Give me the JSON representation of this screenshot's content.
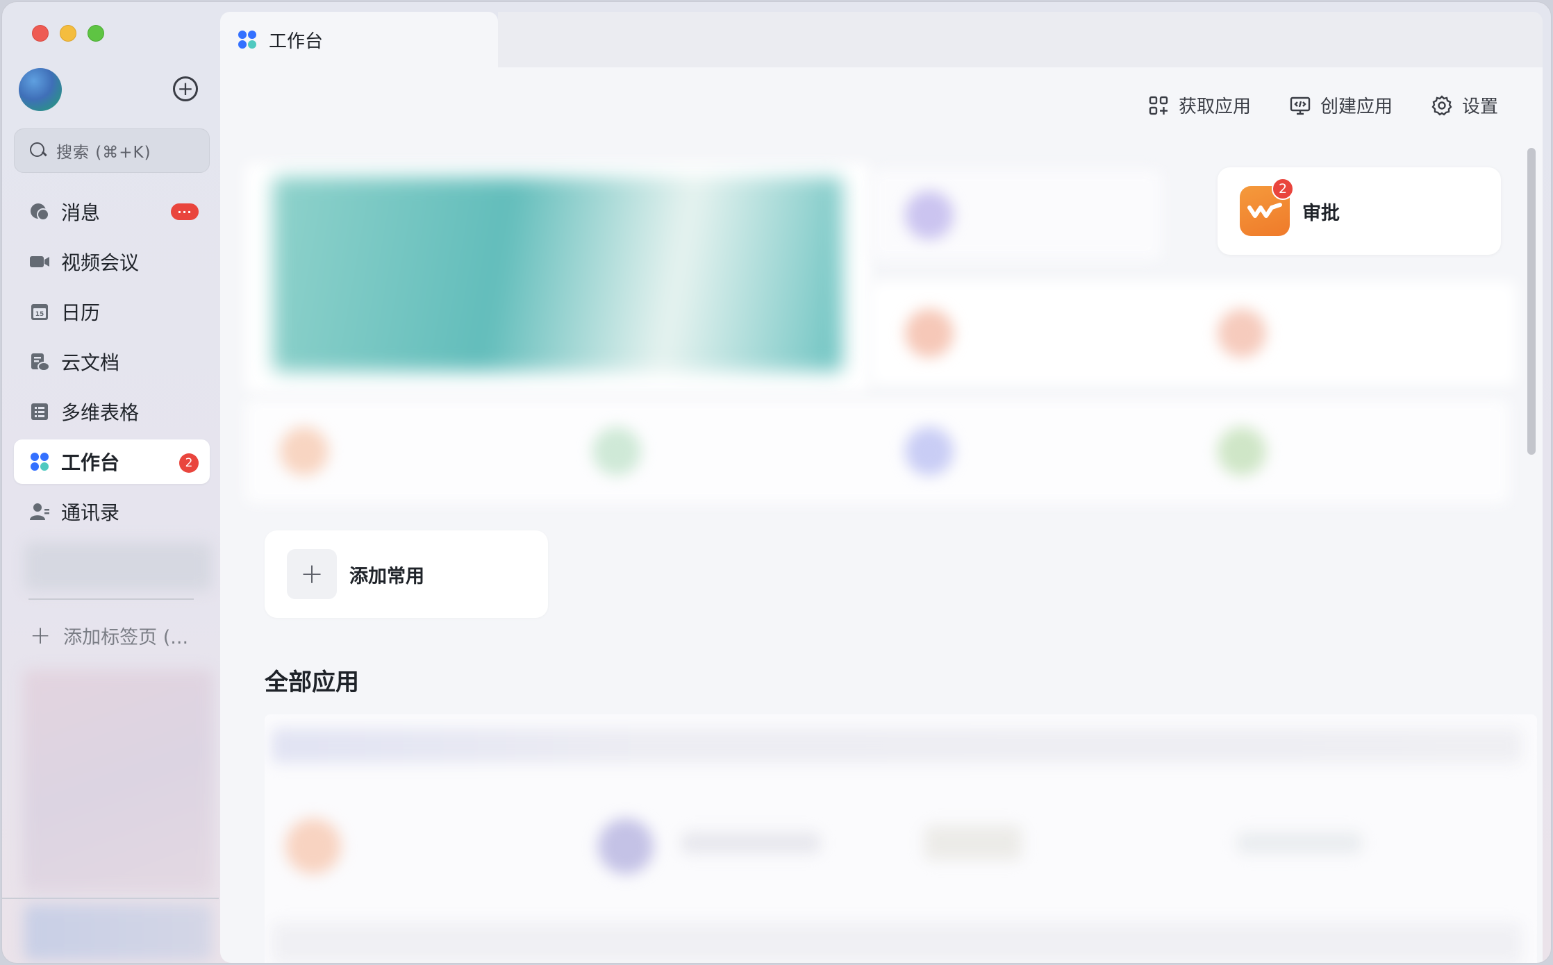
{
  "window": {
    "traffic_lights": [
      "close",
      "minimize",
      "maximize"
    ]
  },
  "sidebar": {
    "search_placeholder": "搜索 (⌘+K)",
    "items": [
      {
        "label": "消息",
        "icon": "chat-bubbles-icon",
        "badge": "···"
      },
      {
        "label": "视频会议",
        "icon": "video-camera-icon"
      },
      {
        "label": "日历",
        "icon": "calendar-icon",
        "icon_text": "15"
      },
      {
        "label": "云文档",
        "icon": "cloud-document-icon"
      },
      {
        "label": "多维表格",
        "icon": "table-icon"
      },
      {
        "label": "工作台",
        "icon": "workspace-icon",
        "badge": "2",
        "active": true
      },
      {
        "label": "通讯录",
        "icon": "contacts-icon"
      }
    ],
    "add_tab_label": "添加标签页 (..."
  },
  "tab": {
    "title": "工作台"
  },
  "toolbar": {
    "get_apps": "获取应用",
    "create_app": "创建应用",
    "settings": "设置"
  },
  "approval": {
    "label": "审批",
    "badge": "2"
  },
  "common": {
    "add_label": "添加常用"
  },
  "all_apps": {
    "title": "全部应用"
  },
  "colors": {
    "accent_blue": "#3370ff",
    "badge_red": "#e9453d",
    "approval_orange": "#ef7a2a"
  }
}
